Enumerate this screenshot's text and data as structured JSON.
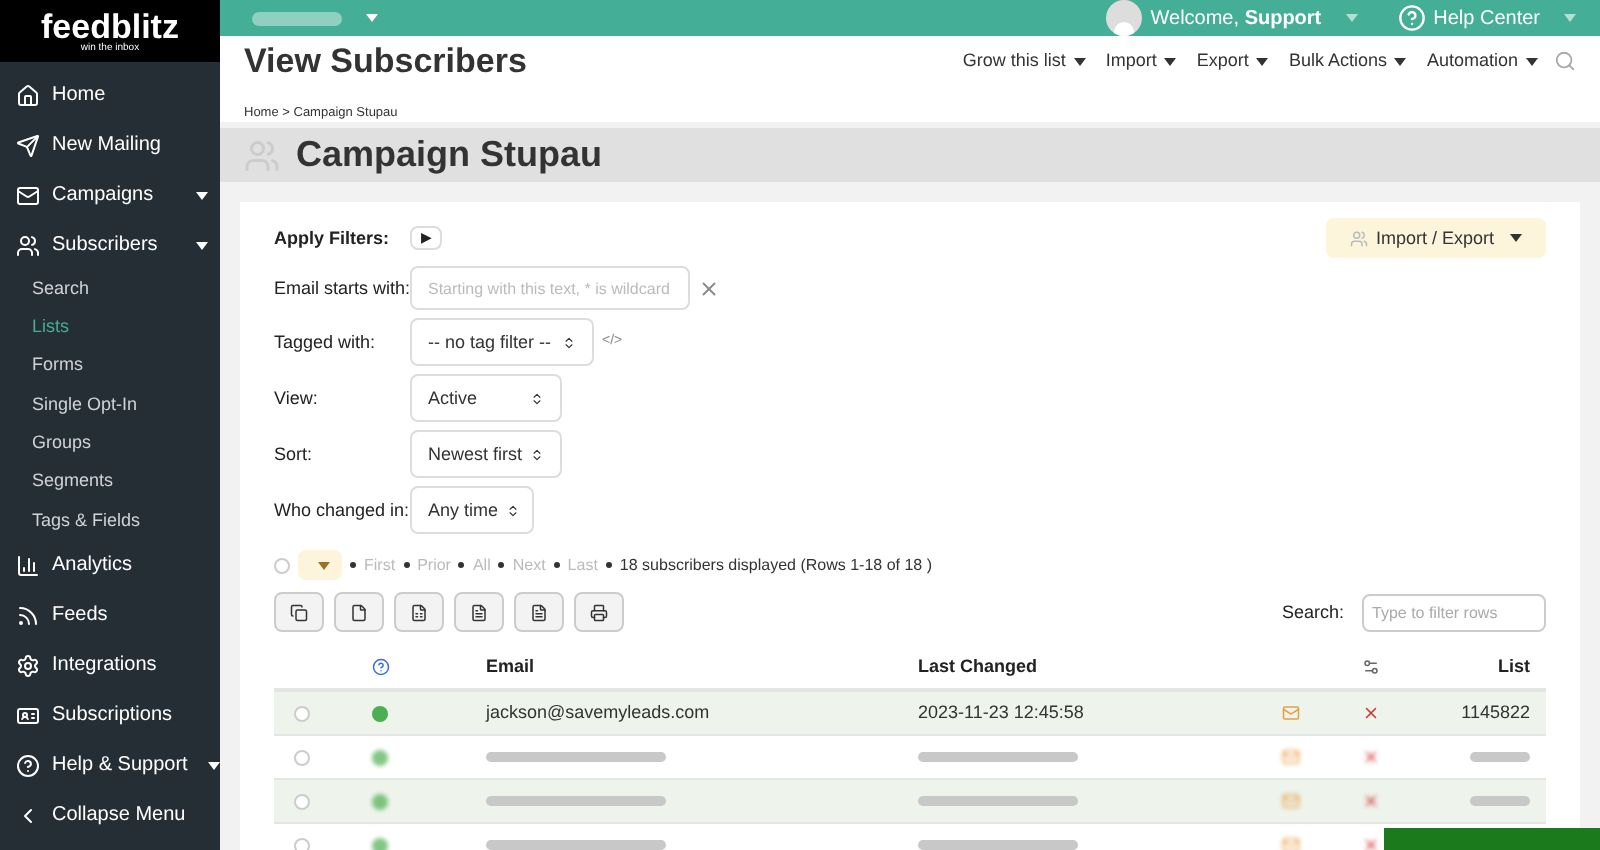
{
  "logo": {
    "name": "feedblitz",
    "tagline": "win the inbox"
  },
  "topbar": {
    "account_blurred": true,
    "welcome": "Welcome,",
    "user": "Support",
    "help": "Help Center"
  },
  "sidebar": {
    "items": [
      {
        "label": "Home",
        "selected": false,
        "caret": false
      },
      {
        "label": "New Mailing",
        "selected": false,
        "caret": false
      },
      {
        "label": "Campaigns",
        "selected": false,
        "caret": true
      },
      {
        "label": "Subscribers",
        "selected": false,
        "caret": true,
        "children": [
          {
            "label": "Search",
            "selected": false
          },
          {
            "label": "Lists",
            "selected": true
          },
          {
            "label": "Forms",
            "selected": false
          },
          {
            "label": "Single Opt-In",
            "selected": false
          },
          {
            "label": "Groups",
            "selected": false
          },
          {
            "label": "Segments",
            "selected": false
          },
          {
            "label": "Tags & Fields",
            "selected": false
          }
        ]
      },
      {
        "label": "Analytics",
        "selected": false,
        "caret": false
      },
      {
        "label": "Feeds",
        "selected": false,
        "caret": false
      },
      {
        "label": "Integrations",
        "selected": false,
        "caret": false
      },
      {
        "label": "Subscriptions",
        "selected": false,
        "caret": false
      },
      {
        "label": "Help & Support",
        "selected": false,
        "caret": true
      },
      {
        "label": "Collapse Menu",
        "selected": false,
        "caret": false
      }
    ]
  },
  "header": {
    "title": "View Subscribers",
    "menu": [
      "Grow this list",
      "Import",
      "Export",
      "Bulk Actions",
      "Automation"
    ],
    "breadcrumb": "Home > Campaign Stupau"
  },
  "page_title": "Campaign Stupau",
  "filters": {
    "apply_label": "Apply Filters:",
    "apply_button": "▶",
    "import_export": "Import / Export",
    "email": {
      "label": "Email starts with:",
      "placeholder": "Starting with this text, * is wildcard"
    },
    "tagged": {
      "label": "Tagged with:",
      "value": "-- no tag filter --",
      "code": "</>"
    },
    "view": {
      "label": "View:",
      "value": "Active"
    },
    "sort": {
      "label": "Sort:",
      "value": "Newest first"
    },
    "changed": {
      "label": "Who changed in:",
      "value": "Any time"
    }
  },
  "pager": {
    "select_all_checked": false,
    "links": [
      "First",
      "Prior",
      "All",
      "Next",
      "Last"
    ],
    "summary": "18 subscribers displayed (Rows 1-18 of 18 )"
  },
  "search": {
    "label": "Search:",
    "placeholder": "Type to filter rows"
  },
  "table": {
    "columns": [
      "Email",
      "Last Changed",
      "List"
    ],
    "rows": [
      {
        "blurred": false,
        "checked": false,
        "email": "jackson@savemyleads.com",
        "last_changed": "2023-11-23 12:45:58",
        "list": "1145822"
      },
      {
        "blurred": true,
        "checked": false
      },
      {
        "blurred": true,
        "checked": false
      },
      {
        "blurred": true,
        "checked": false
      }
    ]
  }
}
